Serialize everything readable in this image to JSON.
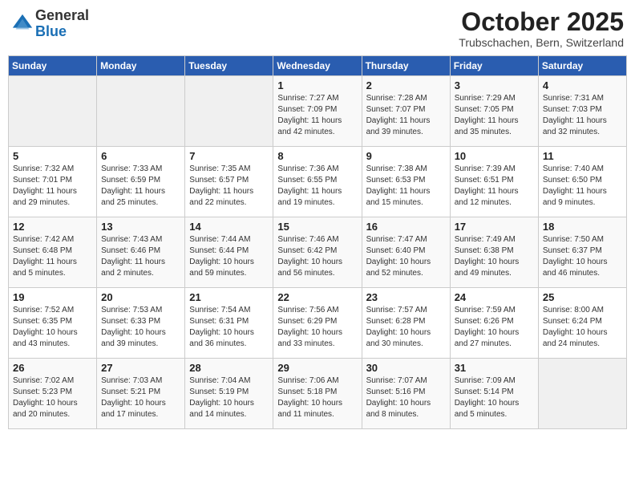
{
  "header": {
    "logo_general": "General",
    "logo_blue": "Blue",
    "month_title": "October 2025",
    "location": "Trubschachen, Bern, Switzerland"
  },
  "calendar": {
    "weekdays": [
      "Sunday",
      "Monday",
      "Tuesday",
      "Wednesday",
      "Thursday",
      "Friday",
      "Saturday"
    ],
    "weeks": [
      [
        {
          "day": "",
          "info": ""
        },
        {
          "day": "",
          "info": ""
        },
        {
          "day": "",
          "info": ""
        },
        {
          "day": "1",
          "info": "Sunrise: 7:27 AM\nSunset: 7:09 PM\nDaylight: 11 hours\nand 42 minutes."
        },
        {
          "day": "2",
          "info": "Sunrise: 7:28 AM\nSunset: 7:07 PM\nDaylight: 11 hours\nand 39 minutes."
        },
        {
          "day": "3",
          "info": "Sunrise: 7:29 AM\nSunset: 7:05 PM\nDaylight: 11 hours\nand 35 minutes."
        },
        {
          "day": "4",
          "info": "Sunrise: 7:31 AM\nSunset: 7:03 PM\nDaylight: 11 hours\nand 32 minutes."
        }
      ],
      [
        {
          "day": "5",
          "info": "Sunrise: 7:32 AM\nSunset: 7:01 PM\nDaylight: 11 hours\nand 29 minutes."
        },
        {
          "day": "6",
          "info": "Sunrise: 7:33 AM\nSunset: 6:59 PM\nDaylight: 11 hours\nand 25 minutes."
        },
        {
          "day": "7",
          "info": "Sunrise: 7:35 AM\nSunset: 6:57 PM\nDaylight: 11 hours\nand 22 minutes."
        },
        {
          "day": "8",
          "info": "Sunrise: 7:36 AM\nSunset: 6:55 PM\nDaylight: 11 hours\nand 19 minutes."
        },
        {
          "day": "9",
          "info": "Sunrise: 7:38 AM\nSunset: 6:53 PM\nDaylight: 11 hours\nand 15 minutes."
        },
        {
          "day": "10",
          "info": "Sunrise: 7:39 AM\nSunset: 6:51 PM\nDaylight: 11 hours\nand 12 minutes."
        },
        {
          "day": "11",
          "info": "Sunrise: 7:40 AM\nSunset: 6:50 PM\nDaylight: 11 hours\nand 9 minutes."
        }
      ],
      [
        {
          "day": "12",
          "info": "Sunrise: 7:42 AM\nSunset: 6:48 PM\nDaylight: 11 hours\nand 5 minutes."
        },
        {
          "day": "13",
          "info": "Sunrise: 7:43 AM\nSunset: 6:46 PM\nDaylight: 11 hours\nand 2 minutes."
        },
        {
          "day": "14",
          "info": "Sunrise: 7:44 AM\nSunset: 6:44 PM\nDaylight: 10 hours\nand 59 minutes."
        },
        {
          "day": "15",
          "info": "Sunrise: 7:46 AM\nSunset: 6:42 PM\nDaylight: 10 hours\nand 56 minutes."
        },
        {
          "day": "16",
          "info": "Sunrise: 7:47 AM\nSunset: 6:40 PM\nDaylight: 10 hours\nand 52 minutes."
        },
        {
          "day": "17",
          "info": "Sunrise: 7:49 AM\nSunset: 6:38 PM\nDaylight: 10 hours\nand 49 minutes."
        },
        {
          "day": "18",
          "info": "Sunrise: 7:50 AM\nSunset: 6:37 PM\nDaylight: 10 hours\nand 46 minutes."
        }
      ],
      [
        {
          "day": "19",
          "info": "Sunrise: 7:52 AM\nSunset: 6:35 PM\nDaylight: 10 hours\nand 43 minutes."
        },
        {
          "day": "20",
          "info": "Sunrise: 7:53 AM\nSunset: 6:33 PM\nDaylight: 10 hours\nand 39 minutes."
        },
        {
          "day": "21",
          "info": "Sunrise: 7:54 AM\nSunset: 6:31 PM\nDaylight: 10 hours\nand 36 minutes."
        },
        {
          "day": "22",
          "info": "Sunrise: 7:56 AM\nSunset: 6:29 PM\nDaylight: 10 hours\nand 33 minutes."
        },
        {
          "day": "23",
          "info": "Sunrise: 7:57 AM\nSunset: 6:28 PM\nDaylight: 10 hours\nand 30 minutes."
        },
        {
          "day": "24",
          "info": "Sunrise: 7:59 AM\nSunset: 6:26 PM\nDaylight: 10 hours\nand 27 minutes."
        },
        {
          "day": "25",
          "info": "Sunrise: 8:00 AM\nSunset: 6:24 PM\nDaylight: 10 hours\nand 24 minutes."
        }
      ],
      [
        {
          "day": "26",
          "info": "Sunrise: 7:02 AM\nSunset: 5:23 PM\nDaylight: 10 hours\nand 20 minutes."
        },
        {
          "day": "27",
          "info": "Sunrise: 7:03 AM\nSunset: 5:21 PM\nDaylight: 10 hours\nand 17 minutes."
        },
        {
          "day": "28",
          "info": "Sunrise: 7:04 AM\nSunset: 5:19 PM\nDaylight: 10 hours\nand 14 minutes."
        },
        {
          "day": "29",
          "info": "Sunrise: 7:06 AM\nSunset: 5:18 PM\nDaylight: 10 hours\nand 11 minutes."
        },
        {
          "day": "30",
          "info": "Sunrise: 7:07 AM\nSunset: 5:16 PM\nDaylight: 10 hours\nand 8 minutes."
        },
        {
          "day": "31",
          "info": "Sunrise: 7:09 AM\nSunset: 5:14 PM\nDaylight: 10 hours\nand 5 minutes."
        },
        {
          "day": "",
          "info": ""
        }
      ]
    ]
  }
}
